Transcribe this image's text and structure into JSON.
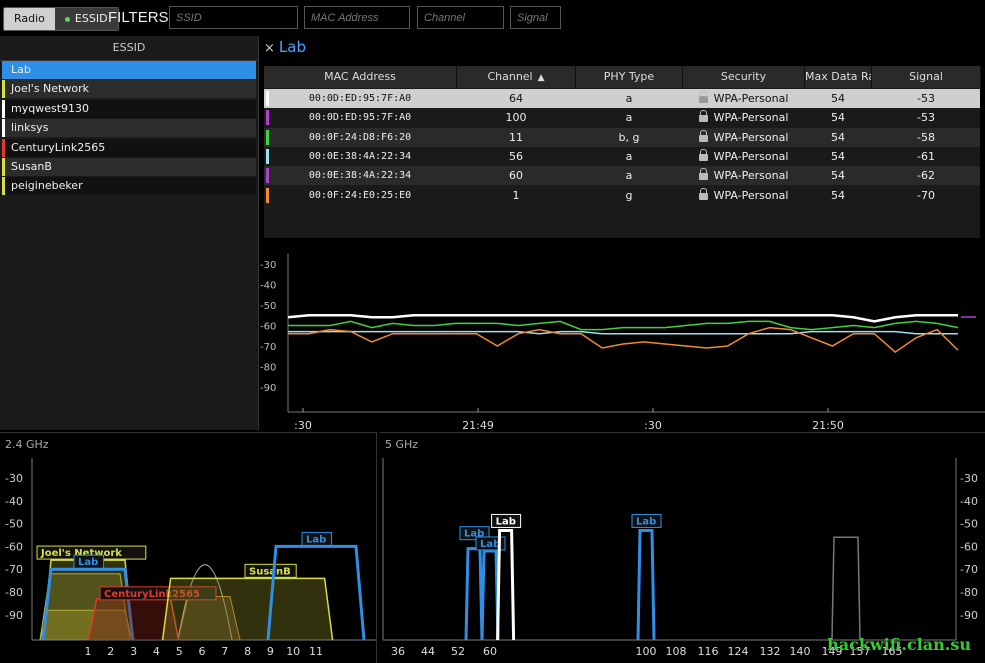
{
  "toolbar": {
    "radio_label": "Radio",
    "essid_label": "ESSID",
    "filters_label": "FILTERS:",
    "ssid_placeholder": "SSID",
    "mac_placeholder": "MAC Address",
    "channel_placeholder": "Channel",
    "signal_placeholder": "Signal"
  },
  "essid_panel": {
    "header": "ESSID",
    "items": [
      {
        "label": "Lab",
        "color": "#2f8fe6",
        "selected": true
      },
      {
        "label": "Joel's Network",
        "color": "#d6e040"
      },
      {
        "label": "myqwest9130",
        "color": "#ffffff"
      },
      {
        "label": "linksys",
        "color": "#ffffff"
      },
      {
        "label": "CenturyLink2565",
        "color": "#e03a2a"
      },
      {
        "label": "SusanB",
        "color": "#d6e040"
      },
      {
        "label": "peiginebeker",
        "color": "#d6e040"
      }
    ]
  },
  "network": {
    "title": "Lab",
    "close_icon": "×",
    "columns": [
      "MAC Address",
      "Channel",
      "PHY Type",
      "Security",
      "Max Data Ra",
      "Signal"
    ],
    "sort_indicator": "▲",
    "rows": [
      {
        "mac": "00:0D:ED:95:7F:A0",
        "channel": "64",
        "phy": "a",
        "security": "WPA-Personal",
        "rate": "54",
        "signal": "-53",
        "color": "#ffffff"
      },
      {
        "mac": "00:0D:ED:95:7F:A0",
        "channel": "100",
        "phy": "a",
        "security": "WPA-Personal",
        "rate": "54",
        "signal": "-53",
        "color": "#b040d0"
      },
      {
        "mac": "00:0F:24:D8:F6:20",
        "channel": "11",
        "phy": "b, g",
        "security": "WPA-Personal",
        "rate": "54",
        "signal": "-58",
        "color": "#40d040"
      },
      {
        "mac": "00:0E:38:4A:22:34",
        "channel": "56",
        "phy": "a",
        "security": "WPA-Personal",
        "rate": "54",
        "signal": "-61",
        "color": "#9fe0f0"
      },
      {
        "mac": "00:0E:38:4A:22:34",
        "channel": "60",
        "phy": "a",
        "security": "WPA-Personal",
        "rate": "54",
        "signal": "-62",
        "color": "#b040d0"
      },
      {
        "mac": "00:0F:24:E0:25:E0",
        "channel": "1",
        "phy": "g",
        "security": "WPA-Personal",
        "rate": "54",
        "signal": "-70",
        "color": "#f08a30"
      }
    ]
  },
  "time_chart": {
    "y_ticks": [
      "-30",
      "-40",
      "-50",
      "-60",
      "-70",
      "-80",
      "-90"
    ],
    "x_ticks": [
      ":30",
      "21:49",
      ":30",
      "21:50"
    ],
    "series": [
      {
        "color": "#ffffff",
        "values": [
          -56,
          -55,
          -55,
          -55,
          -56,
          -56,
          -55,
          -55,
          -55,
          -55,
          -55,
          -55,
          -55,
          -55,
          -55,
          -55,
          -55,
          -55,
          -55,
          -55,
          -55,
          -55,
          -55,
          -55,
          -55,
          -55,
          -55,
          -56,
          -58,
          -56,
          -55,
          -55,
          -55
        ]
      },
      {
        "color": "#40d040",
        "values": [
          -60,
          -60,
          -60,
          -58,
          -61,
          -59,
          -60,
          -60,
          -59,
          -59,
          -59,
          -60,
          -59,
          -58,
          -62,
          -62,
          -61,
          -61,
          -61,
          -60,
          -59,
          -59,
          -58,
          -58,
          -61,
          -62,
          -61,
          -60,
          -61,
          -59,
          -58,
          -59,
          -61
        ]
      },
      {
        "color": "#9fe0f0",
        "values": [
          -63,
          -63,
          -63,
          -63,
          -63,
          -63,
          -63,
          -63,
          -63,
          -63,
          -63,
          -63,
          -64,
          -63,
          -63,
          -64,
          -64,
          -64,
          -64,
          -64,
          -64,
          -64,
          -64,
          -64,
          -64,
          -63,
          -63,
          -63,
          -63,
          -63,
          -64,
          -64,
          -64
        ]
      },
      {
        "color": "#f08a30",
        "values": [
          -64,
          -64,
          -62,
          -63,
          -68,
          -64,
          -64,
          -64,
          -64,
          -64,
          -70,
          -64,
          -62,
          -64,
          -64,
          -71,
          -69,
          -68,
          -69,
          -70,
          -71,
          -70,
          -64,
          -61,
          -62,
          -66,
          -70,
          -64,
          -64,
          -73,
          -66,
          -62,
          -72
        ]
      }
    ]
  },
  "band24": {
    "title": "2.4 GHz",
    "y_ticks": [
      "-30",
      "-40",
      "-50",
      "-60",
      "-70",
      "-80",
      "-90"
    ],
    "x_ticks": [
      "1",
      "2",
      "3",
      "4",
      "5",
      "6",
      "7",
      "8",
      "9",
      "10",
      "11"
    ],
    "networks": [
      {
        "label": "Joel's Network",
        "channel": 1,
        "signal": -66,
        "color": "#d6e040"
      },
      {
        "label": "Lab",
        "channel": 1,
        "signal": -70,
        "color": "#2f8fe6"
      },
      {
        "label": "CenturyLink2565",
        "channel": 3,
        "signal": -83,
        "color": "#e03a2a"
      },
      {
        "label": "SusanB",
        "channel": 8,
        "signal": -74,
        "color": "#d6e040"
      },
      {
        "label": "Lab",
        "channel": 11,
        "signal": -60,
        "color": "#2f8fe6"
      }
    ]
  },
  "band5": {
    "title": "5 GHz",
    "y_ticks": [
      "-30",
      "-40",
      "-50",
      "-60",
      "-70",
      "-80",
      "-90"
    ],
    "x_ticks": [
      "36",
      "44",
      "52",
      "60",
      "100",
      "108",
      "116",
      "124",
      "132",
      "140",
      "149",
      "157",
      "165"
    ],
    "networks": [
      {
        "label": "Lab",
        "channel": 56,
        "signal": -61,
        "color": "#2f8fe6"
      },
      {
        "label": "Lab",
        "channel": 60,
        "signal": -62,
        "color": "#2f8fe6"
      },
      {
        "label": "Lab",
        "channel": 64,
        "signal": -53,
        "color": "#ffffff"
      },
      {
        "label": "Lab",
        "channel": 100,
        "signal": -53,
        "color": "#2f8fe6"
      },
      {
        "label": "",
        "channel": 153,
        "signal": -56,
        "color": "#777777"
      }
    ]
  },
  "watermark": "hackwifi.clan.su"
}
